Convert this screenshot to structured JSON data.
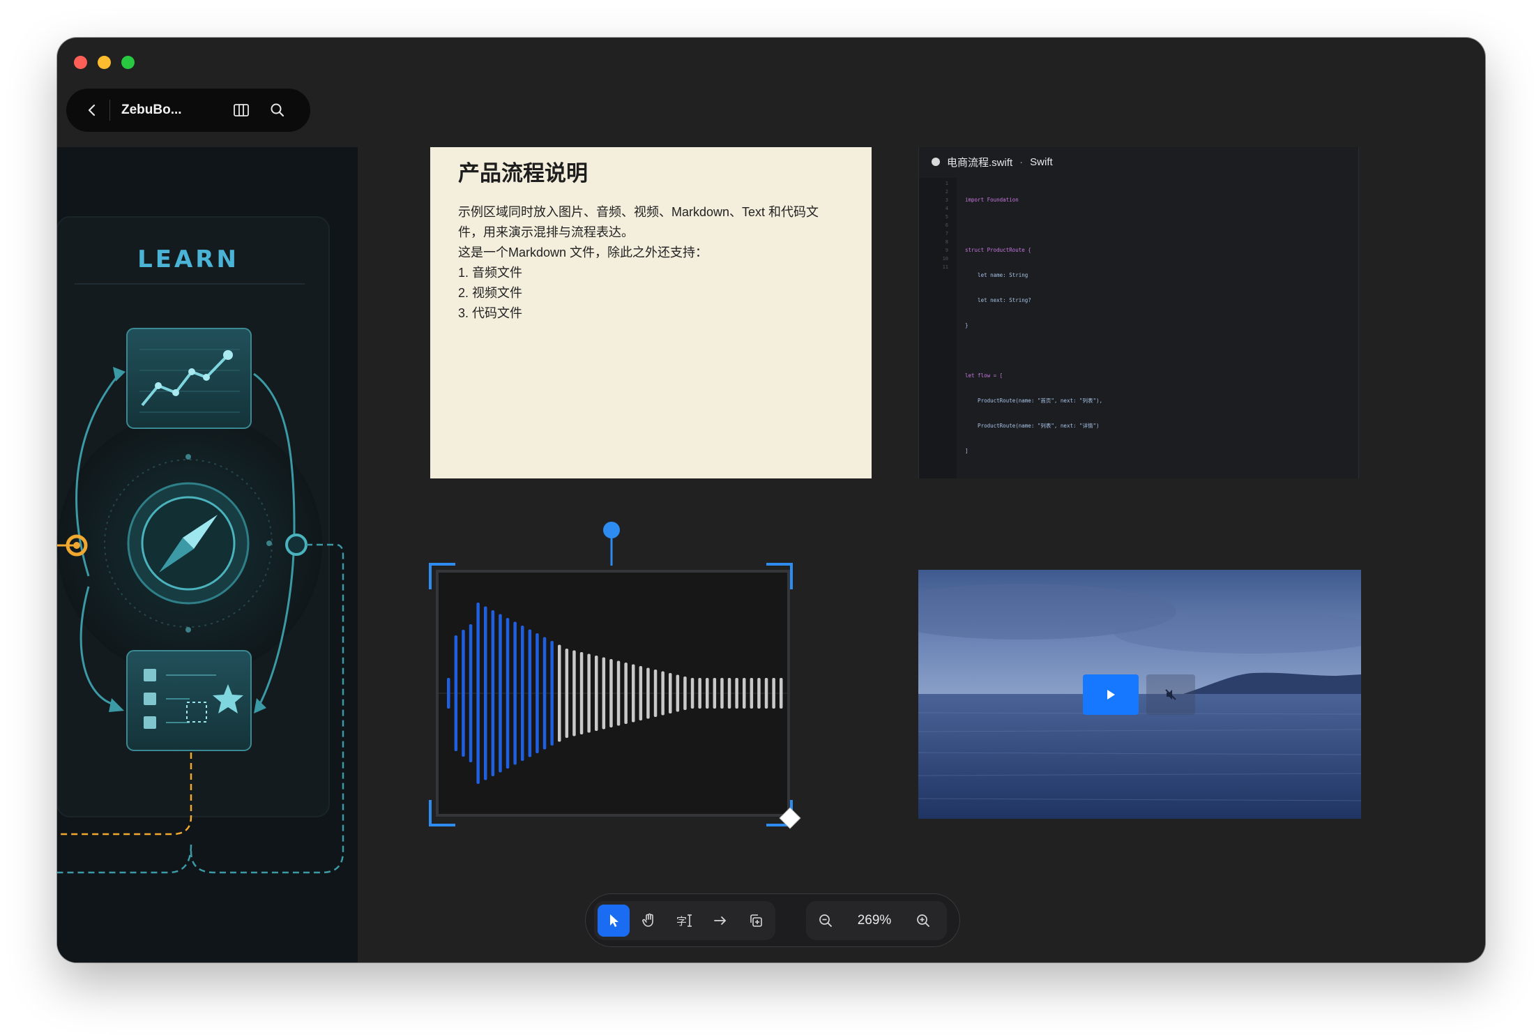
{
  "window": {
    "title": "ZebuBo..."
  },
  "left_panel": {
    "heading": "LEARN"
  },
  "markdown_card": {
    "title": "产品流程说明",
    "lines": [
      "示例区域同时放入图片、音频、视频、Markdown、Text 和代码文",
      "件，用来演示混排与流程表达。",
      "这是一个Markdown 文件，除此之外还支持：",
      "1. 音频文件",
      "2. 视频文件",
      "3. 代码文件"
    ]
  },
  "code_card": {
    "filename": "电商流程.swift",
    "separator": "·",
    "language": "Swift",
    "line_numbers": [
      "1",
      "2",
      "3",
      "4",
      "5",
      "6",
      "7",
      "8",
      "9",
      "10",
      "11"
    ],
    "lines": [
      "import Foundation",
      "",
      "struct ProductRoute {",
      "    let name: String",
      "    let next: String?",
      "}",
      "",
      "let flow = [",
      "    ProductRoute(name: \"首页\", next: \"列表\"),",
      "    ProductRoute(name: \"列表\", next: \"详情\")",
      "]"
    ]
  },
  "audio_card": {
    "accent_color": "#1f5fe0",
    "played_fraction": 0.33
  },
  "video_card": {
    "play_icon": "play-icon",
    "mute_icon": "mute-icon"
  },
  "toolbar": {
    "tools": [
      "select-tool",
      "hand-tool",
      "text-tool",
      "arrow-tool",
      "duplicate-tool"
    ],
    "zoom_level": "269%",
    "active_color": "#1a6cf2"
  }
}
